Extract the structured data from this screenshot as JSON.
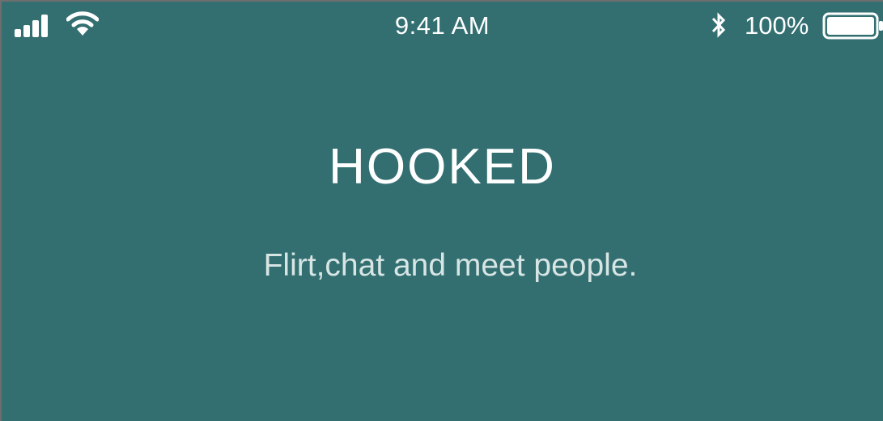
{
  "status_bar": {
    "time": "9:41 AM",
    "battery_percent": "100%",
    "battery_level": 1.0,
    "signal_icon": "cellular-signal-icon",
    "wifi_icon": "wifi-icon",
    "bluetooth_icon": "bluetooth-icon",
    "battery_icon": "battery-full-icon"
  },
  "main": {
    "title": "HOOKED",
    "tagline": "Flirt,chat and meet people."
  },
  "colors": {
    "background": "#336f71",
    "text": "#ffffff",
    "tagline": "#d7e5e4"
  }
}
